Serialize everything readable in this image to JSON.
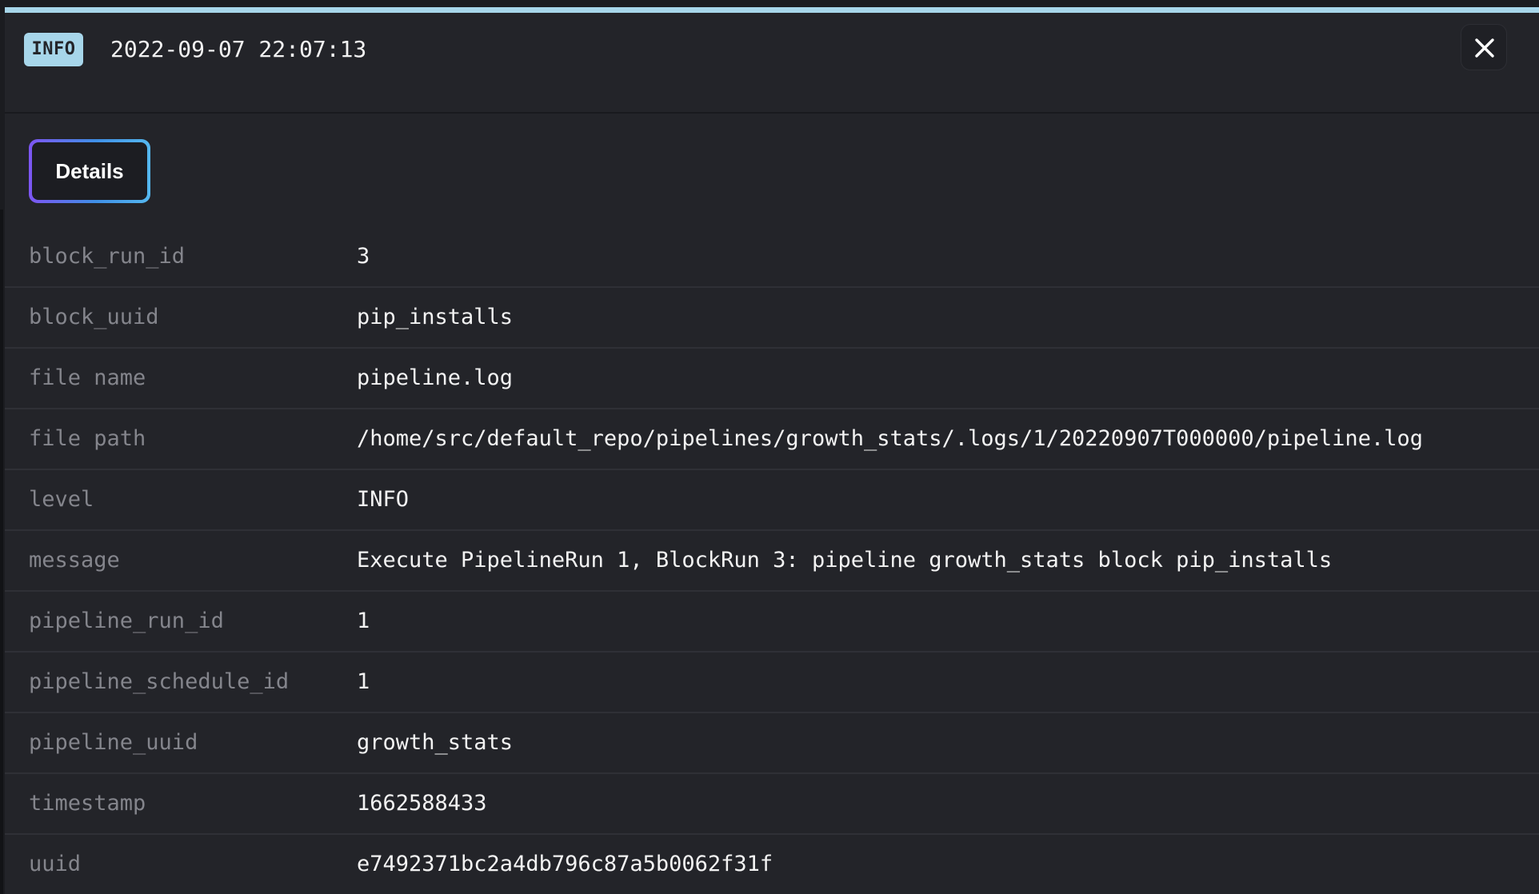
{
  "header": {
    "level_badge": "INFO",
    "timestamp": "2022-09-07 22:07:13",
    "close_icon": "close-icon"
  },
  "colors": {
    "accent": "#a7d6ea",
    "background": "#232429",
    "tab_gradient_start": "#7d55f2",
    "tab_gradient_end": "#55b8f0",
    "key_text": "#84858c",
    "value_text": "#f3f3f3"
  },
  "tabs": [
    {
      "label": "Details",
      "selected": true
    }
  ],
  "details": [
    {
      "key": "block_run_id",
      "value": "3"
    },
    {
      "key": "block_uuid",
      "value": "pip_installs"
    },
    {
      "key": "file name",
      "value": "pipeline.log"
    },
    {
      "key": "file path",
      "value": "/home/src/default_repo/pipelines/growth_stats/.logs/1/20220907T000000/pipeline.log"
    },
    {
      "key": "level",
      "value": "INFO"
    },
    {
      "key": "message",
      "value": "Execute PipelineRun 1, BlockRun 3: pipeline growth_stats block pip_installs"
    },
    {
      "key": "pipeline_run_id",
      "value": "1"
    },
    {
      "key": "pipeline_schedule_id",
      "value": "1"
    },
    {
      "key": "pipeline_uuid",
      "value": "growth_stats"
    },
    {
      "key": "timestamp",
      "value": "1662588433"
    },
    {
      "key": "uuid",
      "value": "e7492371bc2a4db796c87a5b0062f31f"
    }
  ]
}
